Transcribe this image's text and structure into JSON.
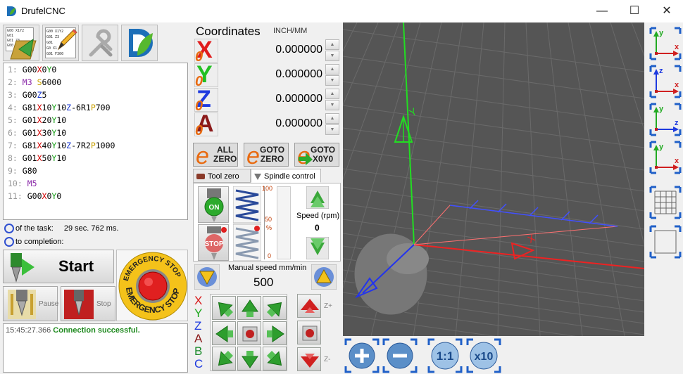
{
  "window": {
    "title": "DrufelCNC",
    "minimize": "—",
    "maximize": "☐",
    "close": "✕"
  },
  "toolbar": {
    "open_icon": "open-gcode-icon",
    "edit_icon": "edit-gcode-icon",
    "settings_icon": "wrench-icon",
    "about_icon": "drufel-logo-icon",
    "open_lines": [
      "G00 X1Y2",
      "G01",
      "G01 Z3",
      "G00"
    ],
    "edit_lines": [
      "G00 X1Y2",
      "G01 Z3",
      "G01",
      "G0 X1",
      "G01 F300"
    ]
  },
  "gcode": {
    "lines": [
      {
        "n": "1:",
        "parts": [
          [
            "G00",
            ""
          ],
          [
            "X",
            "X"
          ],
          [
            "0",
            ""
          ],
          [
            "Y",
            "Y"
          ],
          [
            "0",
            ""
          ]
        ]
      },
      {
        "n": "2:",
        "parts": [
          [
            "M3 ",
            "M"
          ],
          [
            "S",
            "P"
          ],
          [
            "6000",
            ""
          ]
        ]
      },
      {
        "n": "3:",
        "parts": [
          [
            "G00",
            ""
          ],
          [
            "Z",
            "Z"
          ],
          [
            "5",
            ""
          ]
        ]
      },
      {
        "n": "4:",
        "parts": [
          [
            "G81",
            ""
          ],
          [
            "X",
            "X"
          ],
          [
            "10",
            ""
          ],
          [
            "Y",
            "Y"
          ],
          [
            "10",
            ""
          ],
          [
            "Z",
            "Z"
          ],
          [
            "-6R1",
            ""
          ],
          [
            "P",
            "P"
          ],
          [
            "700",
            ""
          ]
        ]
      },
      {
        "n": "5:",
        "parts": [
          [
            "G01",
            ""
          ],
          [
            "X",
            "X"
          ],
          [
            "20",
            ""
          ],
          [
            "Y",
            "Y"
          ],
          [
            "10",
            ""
          ]
        ]
      },
      {
        "n": "6:",
        "parts": [
          [
            "G01",
            ""
          ],
          [
            "X",
            "X"
          ],
          [
            "30",
            ""
          ],
          [
            "Y",
            "Y"
          ],
          [
            "10",
            ""
          ]
        ]
      },
      {
        "n": "7:",
        "parts": [
          [
            "G81",
            ""
          ],
          [
            "X",
            "X"
          ],
          [
            "40",
            ""
          ],
          [
            "Y",
            "Y"
          ],
          [
            "10",
            ""
          ],
          [
            "Z",
            "Z"
          ],
          [
            "-7R2",
            ""
          ],
          [
            "P",
            "P"
          ],
          [
            "1000",
            ""
          ]
        ]
      },
      {
        "n": "8:",
        "parts": [
          [
            "G01",
            ""
          ],
          [
            "X",
            "X"
          ],
          [
            "50",
            ""
          ],
          [
            "Y",
            "Y"
          ],
          [
            "10",
            ""
          ]
        ]
      },
      {
        "n": "9:",
        "parts": [
          [
            "G80",
            ""
          ]
        ]
      },
      {
        "n": "10:",
        "parts": [
          [
            "M5",
            "M"
          ]
        ]
      },
      {
        "n": "11:",
        "parts": [
          [
            "G00",
            ""
          ],
          [
            "X",
            "X"
          ],
          [
            "0",
            ""
          ],
          [
            "Y",
            "Y"
          ],
          [
            "0",
            ""
          ]
        ]
      }
    ]
  },
  "timing": {
    "task_label": "of the task:",
    "task_value": "29 sec. 762 ms.",
    "completion_label": "to completion:"
  },
  "controls": {
    "start": "Start",
    "pause": "Pause",
    "stop": "Stop",
    "estop_top": "EMERGENCY STOP",
    "estop_bottom": "EMERGENCY STOP"
  },
  "log": {
    "time": "15:45:27.366",
    "message": "Connection successful."
  },
  "coordinates": {
    "title": "Coordinates",
    "units": "INCH/MM",
    "axes": [
      {
        "name": "X",
        "value": "0.000000",
        "color": "#e01b1b"
      },
      {
        "name": "Y",
        "value": "0.000000",
        "color": "#22c022"
      },
      {
        "name": "Z",
        "value": "0.000000",
        "color": "#1e3adf"
      },
      {
        "name": "A",
        "value": "0.000000",
        "color": "#8b1a1a"
      }
    ],
    "zero_badge": "0",
    "spin_up": "▲",
    "spin_down": "▼"
  },
  "zero_buttons": {
    "all_zero": [
      "ALL",
      "ZERO"
    ],
    "goto_zero": [
      "GOTO",
      "ZERO"
    ],
    "goto_xy": [
      "GOTO",
      "X0Y0"
    ]
  },
  "tabs": [
    {
      "label": "Tool zero"
    },
    {
      "label": "Spindle control"
    }
  ],
  "spindle": {
    "on": "ON",
    "stop": "STOP",
    "scale_top": "100",
    "scale_mid": "50",
    "scale_pct": "%",
    "scale_bottom": "0",
    "speed_label": "Speed (rpm)",
    "speed_value": "0"
  },
  "manual": {
    "label": "Manual speed mm/min",
    "value": "500"
  },
  "jog": {
    "axis_letters": [
      {
        "t": "X",
        "c": "#d81b1b"
      },
      {
        "t": "Y",
        "c": "#1fa81f"
      },
      {
        "t": "Z",
        "c": "#1e3adf"
      },
      {
        "t": "A",
        "c": "#8b1a1a"
      },
      {
        "t": "B",
        "c": "#1a8a2a"
      },
      {
        "t": "C",
        "c": "#1e3adf"
      }
    ],
    "z_plus": "Z+",
    "z_minus": "Z-"
  },
  "viewport": {
    "y_label": "Y",
    "x_label": "X"
  },
  "view_buttons": [
    {
      "name": "view-xy",
      "a": "y",
      "b": "x"
    },
    {
      "name": "view-xz",
      "a": "z",
      "b": "x"
    },
    {
      "name": "view-zy",
      "a": "y",
      "b": "z"
    },
    {
      "name": "view-3d",
      "a": "y",
      "b": "x"
    }
  ],
  "zoom": {
    "one_to_one": "1:1",
    "x10": "x10"
  }
}
